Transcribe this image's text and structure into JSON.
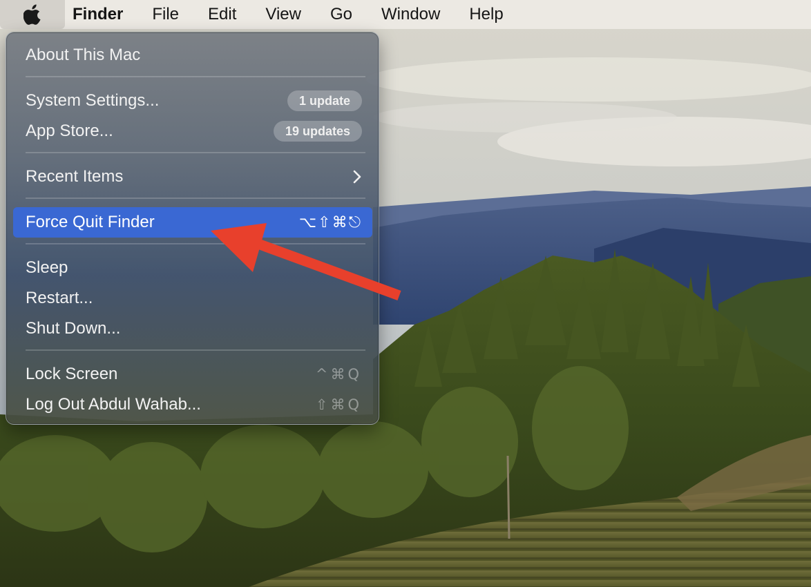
{
  "menubar": {
    "apple_icon": "apple-logo-icon",
    "app_name": "Finder",
    "items": [
      "File",
      "Edit",
      "View",
      "Go",
      "Window",
      "Help"
    ]
  },
  "apple_menu": {
    "about": "About This Mac",
    "system_settings": {
      "label": "System Settings...",
      "badge": "1 update"
    },
    "app_store": {
      "label": "App Store...",
      "badge": "19 updates"
    },
    "recent_items": {
      "label": "Recent Items",
      "icon": "chevron-right-icon"
    },
    "force_quit": {
      "label": "Force Quit Finder",
      "shortcut": "⌥⇧⌘⎋",
      "highlighted": true
    },
    "sleep": "Sleep",
    "restart": "Restart...",
    "shut_down": "Shut Down...",
    "lock_screen": {
      "label": "Lock Screen",
      "shortcut": "^⌘Q"
    },
    "log_out": {
      "label": "Log Out Abdul Wahab...",
      "shortcut": "⇧⌘Q"
    }
  },
  "colors": {
    "highlight": "#3a68d3",
    "annotation_arrow": "#e8402c",
    "menubar": "#ece9e4"
  }
}
